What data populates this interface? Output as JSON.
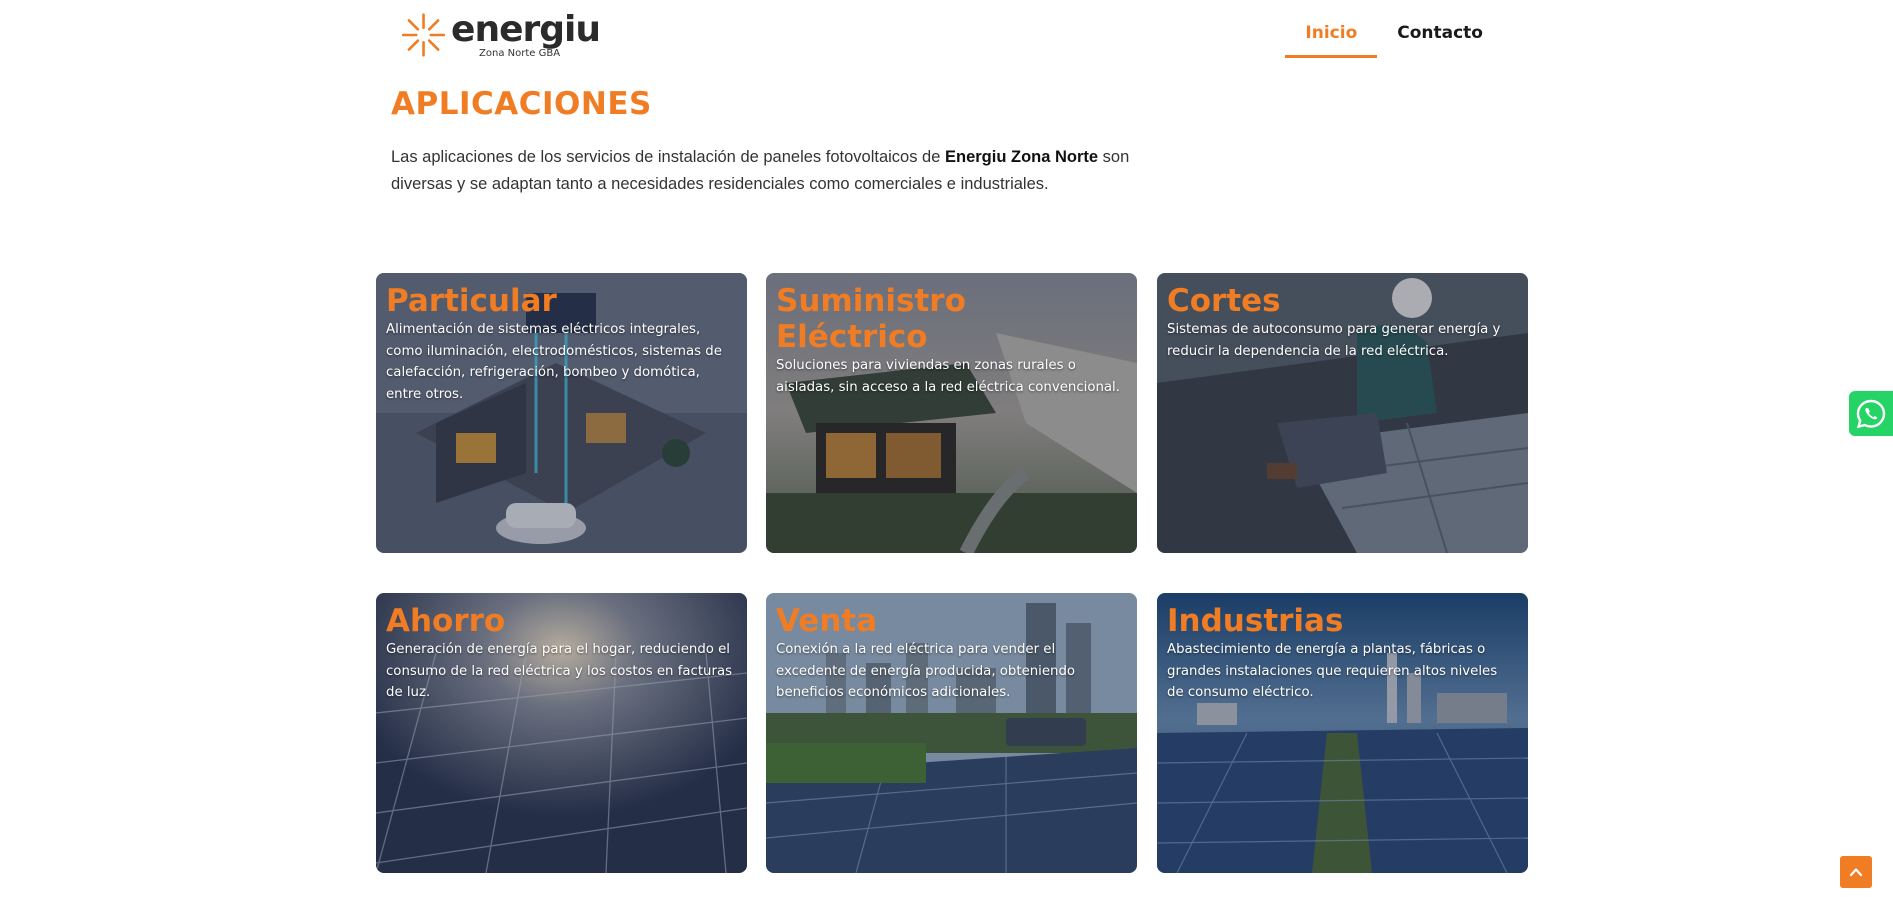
{
  "header": {
    "logo": {
      "word": "energiu",
      "subtitle": "Zona Norte GBA"
    },
    "nav": [
      {
        "label": "Inicio",
        "active": true
      },
      {
        "label": "Contacto",
        "active": false
      }
    ]
  },
  "section": {
    "title": "APLICACIONES",
    "intro_before": "Las aplicaciones de los servicios de instalación de paneles fotovoltaicos de ",
    "intro_bold": "Energiu Zona Norte",
    "intro_after": " son diversas y se adaptan tanto a necesidades residenciales como comerciales e industriales."
  },
  "cards": [
    {
      "title": "Particular",
      "description": "Alimentación de sistemas eléctricos integrales, como iluminación, electrodomésticos, sistemas de calefacción, refrigeración, bombeo y domótica, entre otros.",
      "image": "isometric-smart-home-illustration"
    },
    {
      "title": "Suministro Eléctrico",
      "description": "Soluciones para viviendas en zonas rurales o aisladas, sin acceso a la red eléctrica convencional.",
      "image": "coastal-house-photo"
    },
    {
      "title": "Cortes",
      "description": "Sistemas de autoconsumo para generar energía y reducir la dependencia de la red eléctrica.",
      "image": "technician-installing-panel-photo"
    },
    {
      "title": "Ahorro",
      "description": "Generación de energía para el hogar, reduciendo el consumo de la red eléctrica y los costos en facturas de luz.",
      "image": "solar-panel-closeup-photo"
    },
    {
      "title": "Venta",
      "description": "Conexión a la red eléctrica para vender el excedente de energía producida, obteniendo beneficios económicos adicionales.",
      "image": "city-solar-farm-photo"
    },
    {
      "title": "Industrias",
      "description": "Abastecimiento de energía a plantas, fábricas o grandes instalaciones que requieren altos niveles de consumo eléctrico.",
      "image": "industrial-solar-field-photo"
    }
  ],
  "floating": {
    "whatsapp_icon": "whatsapp-icon",
    "scroll_icon": "chevron-up-icon"
  },
  "colors": {
    "accent": "#f07c23",
    "whatsapp": "#25d366"
  }
}
